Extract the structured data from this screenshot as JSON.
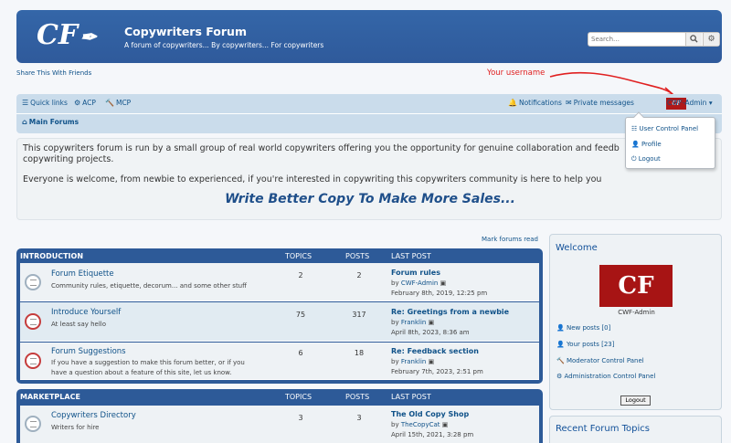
{
  "header": {
    "logo_text": "CF",
    "site_title": "Copywriters Forum",
    "site_description": "A forum of copywriters... By copywriters... For copywriters",
    "search_placeholder": "Search…"
  },
  "share_text": "Share This With Friends",
  "annotation": "Your username",
  "navbar": {
    "quick_links": "Quick links",
    "acp": "ACP",
    "mcp": "MCP",
    "notifications": "Notifications",
    "private_messages": "Private messages",
    "username": "CWF-Admin",
    "breadcrumb": "Main Forums"
  },
  "user_menu": {
    "items": [
      "User Control Panel",
      "Profile",
      "Logout"
    ]
  },
  "notice": {
    "paragraph1_line1": "This copywriters forum is run by a small group of real world copywriters offering you the opportunity for genuine collaboration and feedb",
    "paragraph1_line2": "copywriting projects.",
    "paragraph2": "Everyone is welcome, from newbie to experienced, if you're interested in copywriting this copywriters community is here to help you",
    "slogan": "Write Better Copy To Make More Sales..."
  },
  "mark_forums_read": "Mark forums read",
  "categories": [
    {
      "name": "INTRODUCTION",
      "col_topics": "TOPICS",
      "col_posts": "POSTS",
      "col_last": "LAST POST",
      "forums": [
        {
          "title": "Forum Etiquette",
          "desc1": "Community rules, etiquette, decorum... and some other stuff",
          "desc2": "",
          "topics": "2",
          "posts": "2",
          "last_title": "Forum rules",
          "by": "by",
          "last_user": "CWF-Admin",
          "last_date": "February 8th, 2019, 12:25 pm"
        },
        {
          "title": "Introduce Yourself",
          "desc1": "At least say hello",
          "desc2": "",
          "topics": "75",
          "posts": "317",
          "last_title": "Re: Greetings from a newbie",
          "by": "by",
          "last_user": "Franklin",
          "last_date": "April 8th, 2023, 8:36 am"
        },
        {
          "title": "Forum Suggestions",
          "desc1": "If you have a suggestion to make this forum better, or if you",
          "desc2": "have a question about a feature of this site, let us know.",
          "topics": "6",
          "posts": "18",
          "last_title": "Re: Feedback section",
          "by": "by",
          "last_user": "Franklin",
          "last_date": "February 7th, 2023, 2:51 pm"
        }
      ]
    },
    {
      "name": "MARKETPLACE",
      "col_topics": "TOPICS",
      "col_posts": "POSTS",
      "col_last": "LAST POST",
      "forums": [
        {
          "title": "Copywriters Directory",
          "desc1": "Writers for hire",
          "desc2": "",
          "topics": "3",
          "posts": "3",
          "last_title": "The Old Copy Shop",
          "by": "by",
          "last_user": "TheCopyCat",
          "last_date": "April 15th, 2021, 3:28 pm"
        }
      ]
    }
  ],
  "sidebar": {
    "welcome_title": "Welcome",
    "avatar_text": "CF",
    "avatar_name": "CWF-Admin",
    "links": [
      "New posts [0]",
      "Your posts [23]",
      "Moderator Control Panel",
      "Administration Control Panel"
    ],
    "logout_button": "Logout",
    "recent_title": "Recent Forum Topics"
  }
}
